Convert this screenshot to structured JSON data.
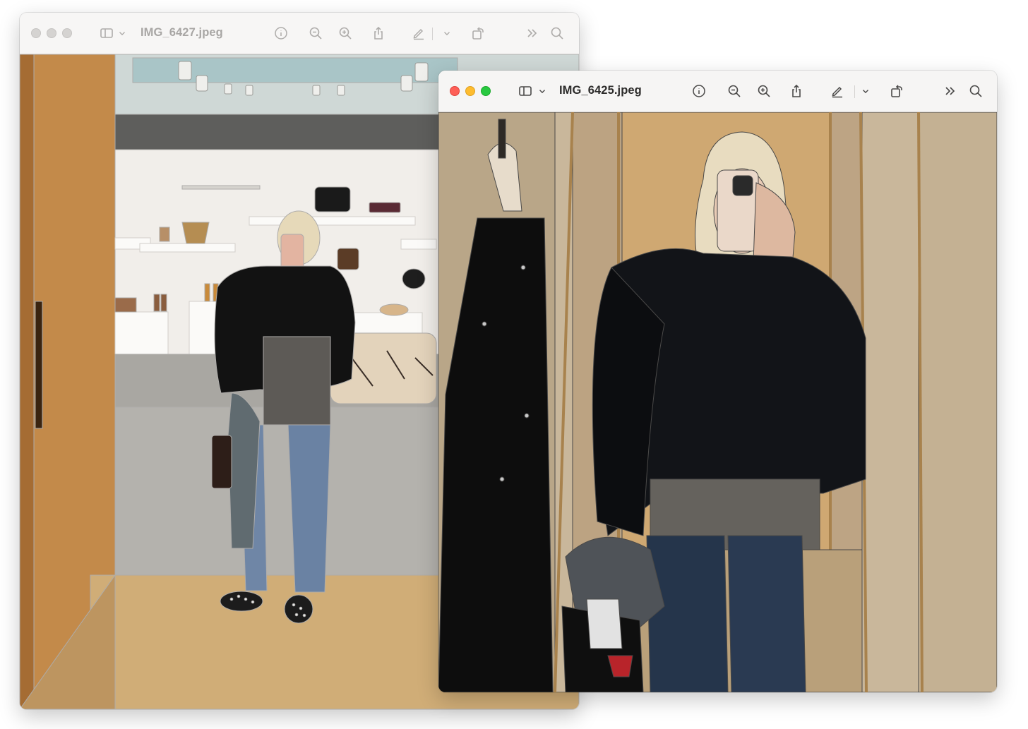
{
  "windows": [
    {
      "title": "IMG_6427.jpeg",
      "state": "inactive",
      "toolbar_icons": [
        "sidebar-icon",
        "chevron-down-icon",
        "info-icon",
        "zoom-out-icon",
        "zoom-in-icon",
        "share-icon",
        "markup-pen-icon",
        "chevron-down-icon",
        "rotate-icon",
        "more-chevrons-icon",
        "search-icon"
      ]
    },
    {
      "title": "IMG_6425.jpeg",
      "state": "active",
      "toolbar_icons": [
        "sidebar-icon",
        "chevron-down-icon",
        "info-icon",
        "zoom-out-icon",
        "zoom-in-icon",
        "share-icon",
        "markup-pen-icon",
        "chevron-down-icon",
        "rotate-icon",
        "more-chevrons-icon",
        "search-icon"
      ]
    }
  ],
  "colors": {
    "traffic_red": "#fe5f57",
    "traffic_yellow": "#febc2e",
    "traffic_green": "#28c840",
    "inactive_light": "#d5d3d1"
  }
}
